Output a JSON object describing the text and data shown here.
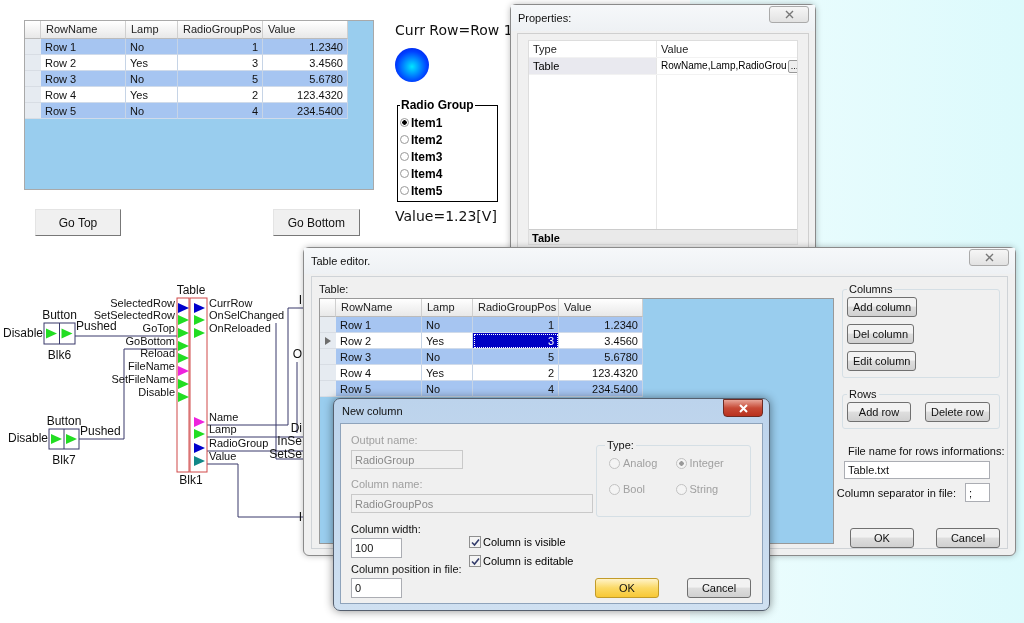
{
  "main_grid": {
    "columns": [
      {
        "label": "RowName"
      },
      {
        "label": "Lamp"
      },
      {
        "label": "RadioGroupPos"
      },
      {
        "label": "Value"
      }
    ],
    "rows": [
      {
        "cells": [
          "Row 1",
          "No",
          "1",
          "1.2340"
        ]
      },
      {
        "cells": [
          "Row 2",
          "Yes",
          "3",
          "3.4560"
        ]
      },
      {
        "cells": [
          "Row 3",
          "No",
          "5",
          "5.6780"
        ]
      },
      {
        "cells": [
          "Row 4",
          "Yes",
          "2",
          "123.4320"
        ]
      },
      {
        "cells": [
          "Row 5",
          "No",
          "4",
          "234.5400"
        ]
      }
    ]
  },
  "current_row_label": "Curr Row=Row 1",
  "lamp": {
    "on": true
  },
  "radio_group": {
    "title": "Radio Group",
    "items": [
      {
        "label": "Item1",
        "selected": true
      },
      {
        "label": "Item2",
        "selected": false
      },
      {
        "label": "Item3",
        "selected": false
      },
      {
        "label": "Item4",
        "selected": false
      },
      {
        "label": "Item5",
        "selected": false
      }
    ]
  },
  "value_label": "Value=1.23[V]",
  "buttons": [
    {
      "label": "Go Top"
    },
    {
      "label": "Go Bottom"
    }
  ],
  "diagram": {
    "button_blocks": [
      {
        "type": "Button",
        "name": "Blk6",
        "input": {
          "label": "Disable",
          "color": "#22dd22"
        },
        "output": {
          "label": "Pushed",
          "color": "#22dd22"
        }
      },
      {
        "type": "Button",
        "name": "Blk7",
        "input": {
          "label": "Disable",
          "color": "#22dd22"
        },
        "output": {
          "label": "Pushed",
          "color": "#22dd22"
        }
      }
    ],
    "table_block": {
      "type": "Table",
      "name": "Blk1",
      "inputs": [
        {
          "label": "SelectedRow",
          "color": "#0000cc"
        },
        {
          "label": "SetSelectedRow",
          "color": "#22dd22"
        },
        {
          "label": "GoTop",
          "color": "#22dd22"
        },
        {
          "label": "GoBottom",
          "color": "#22dd22"
        },
        {
          "label": "Reload",
          "color": "#22dd22"
        },
        {
          "label": "FileName",
          "color": "#ee22dd"
        },
        {
          "label": "SetFileName",
          "color": "#22dd22"
        },
        {
          "label": "Disable",
          "color": "#22dd22"
        }
      ],
      "outputs": [
        {
          "label": "CurrRow",
          "color": "#0000cc"
        },
        {
          "label": "OnSelChanged",
          "color": "#22dd22"
        },
        {
          "label": "OnReloaded",
          "color": "#22dd22"
        },
        {
          "label": "Name",
          "color": "#ee22dd"
        },
        {
          "label": "Lamp",
          "color": "#22dd22"
        },
        {
          "label": "RadioGroup",
          "color": "#0000cc"
        },
        {
          "label": "Value",
          "color": "#118888"
        }
      ]
    },
    "partial_labels": [
      "I",
      "O",
      "Di",
      "InSe",
      "SetSe",
      "I"
    ]
  },
  "properties_window": {
    "title": "Properties:",
    "columns": [
      "Type",
      "Value"
    ],
    "row": {
      "type": "Table",
      "value": "RowName,Lamp,RadioGrou",
      "button": "..."
    },
    "description": "Table"
  },
  "table_editor": {
    "title": "Table editor.",
    "table_label": "Table:",
    "columns": [
      {
        "label": "RowName"
      },
      {
        "label": "Lamp"
      },
      {
        "label": "RadioGroupPos"
      },
      {
        "label": "Value"
      }
    ],
    "rows": [
      {
        "current": false,
        "cells": [
          {
            "text": "Row 1",
            "selected": false
          },
          {
            "text": "No",
            "selected": false
          },
          {
            "text": "1",
            "selected": false
          },
          {
            "text": "1.2340",
            "selected": false
          }
        ]
      },
      {
        "current": true,
        "cells": [
          {
            "text": "Row 2",
            "selected": false
          },
          {
            "text": "Yes",
            "selected": false
          },
          {
            "text": "3",
            "selected": true
          },
          {
            "text": "3.4560",
            "selected": false
          }
        ]
      },
      {
        "current": false,
        "cells": [
          {
            "text": "Row 3",
            "selected": false
          },
          {
            "text": "No",
            "selected": false
          },
          {
            "text": "5",
            "selected": false
          },
          {
            "text": "5.6780",
            "selected": false
          }
        ]
      },
      {
        "current": false,
        "cells": [
          {
            "text": "Row 4",
            "selected": false
          },
          {
            "text": "Yes",
            "selected": false
          },
          {
            "text": "2",
            "selected": false
          },
          {
            "text": "123.4320",
            "selected": false
          }
        ]
      },
      {
        "current": false,
        "cells": [
          {
            "text": "Row 5",
            "selected": false
          },
          {
            "text": "No",
            "selected": false
          },
          {
            "text": "4",
            "selected": false
          },
          {
            "text": "234.5400",
            "selected": false
          }
        ]
      }
    ],
    "columns_group": {
      "title": "Columns",
      "buttons": [
        "Add column",
        "Del column",
        "Edit column"
      ]
    },
    "rows_group": {
      "title": "Rows",
      "buttons": [
        "Add row",
        "Delete row"
      ]
    },
    "file_label": "File name for rows informations:",
    "file_value": "Table.txt",
    "separator_label": "Column separator in file:",
    "separator_value": ";",
    "ok": "OK",
    "cancel": "Cancel"
  },
  "new_column_dialog": {
    "title": "New column",
    "fields": [
      {
        "label": "Output name:",
        "value": "RadioGroup",
        "disabled": true
      },
      {
        "label": "Column name:",
        "value": "RadioGroupPos",
        "disabled": true
      }
    ],
    "type_group": {
      "title": "Type:",
      "disabled": true,
      "options": [
        {
          "label": "Analog",
          "selected": false
        },
        {
          "label": "Integer",
          "selected": true
        },
        {
          "label": "Bool",
          "selected": false
        },
        {
          "label": "String",
          "selected": false
        }
      ]
    },
    "width_label": "Column width:",
    "width_value": "100",
    "position_label": "Column position in file:",
    "position_value": "0",
    "checkboxes": [
      {
        "label": "Column is visible",
        "checked": true
      },
      {
        "label": "Column is editable",
        "checked": true
      }
    ],
    "ok": "OK",
    "cancel": "Cancel"
  }
}
